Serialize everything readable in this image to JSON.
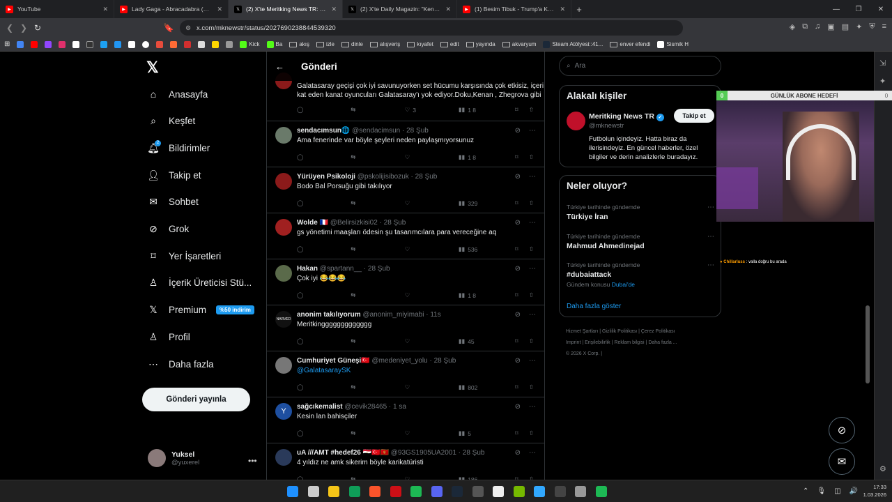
{
  "tabs": [
    {
      "title": "YouTube",
      "icon": "youtube-icon",
      "color": "#ff0000",
      "active": false
    },
    {
      "title": "Lady Gaga - Abracadabra (Official Mu",
      "icon": "youtube-icon",
      "color": "#ff0000",
      "active": false
    },
    {
      "title": "(2) X'te Meritking News TR: \"😍",
      "icon": "x-icon",
      "color": "#ffffff",
      "active": true
    },
    {
      "title": "(2) X'te Daily Magazin: \"Kendall Jenne",
      "icon": "x-icon",
      "color": "#ffffff",
      "active": false
    },
    {
      "title": "(1) Besim Tibuk - Trump'a Kayyor On",
      "icon": "youtube-icon",
      "color": "#ff0000",
      "active": false
    }
  ],
  "url": "x.com/mknewstr/status/2027690238844539320",
  "bookmarks": [
    {
      "label": "Kick",
      "color": "#53fc18"
    },
    {
      "label": "Ba",
      "color": "#53fc18"
    },
    {
      "label": "akış",
      "folder": true
    },
    {
      "label": "izle",
      "folder": true
    },
    {
      "label": "dinle",
      "folder": true
    },
    {
      "label": "alışveriş",
      "folder": true
    },
    {
      "label": "kıyafet",
      "folder": true
    },
    {
      "label": "edit",
      "folder": true
    },
    {
      "label": "yayında",
      "folder": true
    },
    {
      "label": "akvaryum",
      "folder": true
    },
    {
      "label": "Steam Atölyesi::41...",
      "color": "#1b2838"
    },
    {
      "label": "enver efendi",
      "folder": true
    },
    {
      "label": "Sismik H",
      "color": "#ffffff"
    }
  ],
  "nav": {
    "items": [
      {
        "label": "Anasayfa",
        "icon": "home-icon"
      },
      {
        "label": "Keşfet",
        "icon": "search-icon"
      },
      {
        "label": "Bildirimler",
        "icon": "bell-icon",
        "count": "2"
      },
      {
        "label": "Takip et",
        "icon": "follow-icon"
      },
      {
        "label": "Sohbet",
        "icon": "mail-icon"
      },
      {
        "label": "Grok",
        "icon": "grok-icon"
      },
      {
        "label": "Yer İşaretleri",
        "icon": "bookmark-icon"
      },
      {
        "label": "İçerik Üreticisi Stü...",
        "icon": "creator-studio-icon"
      },
      {
        "label": "Premium",
        "icon": "x-premium-icon",
        "badge": "%50 indirim"
      },
      {
        "label": "Profil",
        "icon": "profile-icon"
      },
      {
        "label": "Daha fazla",
        "icon": "more-icon"
      }
    ],
    "post_button": "Gönderi yayınla",
    "me": {
      "name": "Yuksel",
      "handle": "@yuxerel"
    }
  },
  "center": {
    "title": "Gönderi",
    "top_reply": {
      "text1": "Galatasaray geçişi çok iyi savunuyorken set hücumu karşısında çok etkisiz, içeri",
      "text2": "kat eden kanat oyuncuları Galatasaray'ı yok ediyor.Doku,Kenan , Zhegrova gibi",
      "likes": "3",
      "views": "1 8"
    },
    "replies": [
      {
        "name": "sendacımsun🌐",
        "handle": "@sendacimsun",
        "time": "28 Şub",
        "text": "Ama  fenerinde  var  böyle  şeyleri   neden  paylaşmıyorsunuz",
        "likes": "",
        "views": "1 8",
        "avatar": "#6a7a6a"
      },
      {
        "name": "Yürüyen Psikoloji",
        "handle": "@pskolijisibozuk",
        "time": "28 Şub",
        "text": "Bodo Bal Porsuğu gibi takılıyor",
        "likes": "",
        "views": "329",
        "avatar": "#8b1a1a"
      },
      {
        "name": "Wolde 🇫🇷",
        "handle": "@Belirsizkisi02",
        "time": "28 Şub",
        "text": "gs yönetimi maaşları ödesin şu tasarımcılara para vereceğine aq",
        "likes": "",
        "views": "536",
        "avatar": "#a02020"
      },
      {
        "name": "Hakan",
        "handle": "@spartann__",
        "time": "28 Şub",
        "text": "Çok iyi 😂😂😂",
        "likes": "",
        "views": "1 8",
        "avatar": "#5a6a4a"
      },
      {
        "name": "anonim takılıyorum",
        "handle": "@anonim_miyimabi",
        "time": "11s",
        "text": "Meritkinggggggggggggg",
        "likes": "",
        "views": "45",
        "avatar": "#111111",
        "avatar_text": "NARVED"
      },
      {
        "name": "Cumhuriyet Güneşi🇹🇷",
        "handle": "@medeniyet_yolu",
        "time": "28 Şub",
        "text": "@GalatasaraySK",
        "link": true,
        "likes": "",
        "views": "802",
        "avatar": "#777777"
      },
      {
        "name": "sağcıkemalist",
        "handle": "@cevik28465",
        "time": "1 sa",
        "text": "Kesin lan bahisçiler",
        "likes": "",
        "views": "5",
        "avatar": "#1e4fa0",
        "avatar_text": "Y"
      },
      {
        "name": "uA ///AMT #hedef26 🇪🇬🇹🇷🇲🇪",
        "handle": "@93GS1905UA2001",
        "time": "28 Şub",
        "text": "4 yıldız ne amk sikerim böyle karikatüristi",
        "likes": "",
        "views": "186",
        "avatar": "#2a3a5a"
      }
    ]
  },
  "right": {
    "search_placeholder": "Ara",
    "related_title": "Alakalı kişiler",
    "related": {
      "name": "Meritking News TR",
      "handle": "@mknewstr",
      "follow": "Takip et",
      "bio": "Futbolun içindeyiz. Hatta biraz da ilerisindeyiz. En güncel haberler, özel bilgiler ve derin analizlerle buradayız."
    },
    "trends_title": "Neler oluyor?",
    "trends": [
      {
        "category": "Türkiye tarihinde gündemde",
        "name": "Türkiye İran"
      },
      {
        "category": "Türkiye tarihinde gündemde",
        "name": "Mahmud Ahmedinejad"
      },
      {
        "category": "Türkiye tarihinde gündemde",
        "name": "#dubaiattack",
        "sub": "Gündem konusu",
        "sublink": "Dubai'de"
      }
    ],
    "show_more": "Daha fazla göster",
    "footer": [
      "Hizmet Şartları",
      "Gizlilik Politikası",
      "Çerez Politikası",
      "Imprint",
      "Erişilebilirlik",
      "Reklam bilgisi",
      "Daha fazla ...",
      "© 2026 X Corp."
    ]
  },
  "overlay": {
    "goal_title": "GÜNLÜK ABONE HEDEFİ",
    "goal_value": "0",
    "goal_target": "0",
    "chat_user": "Chillarluss",
    "chat_msg": ": valla doğru bu arada"
  },
  "taskbar": {
    "time": "17:33",
    "date": "1.03.2026"
  }
}
